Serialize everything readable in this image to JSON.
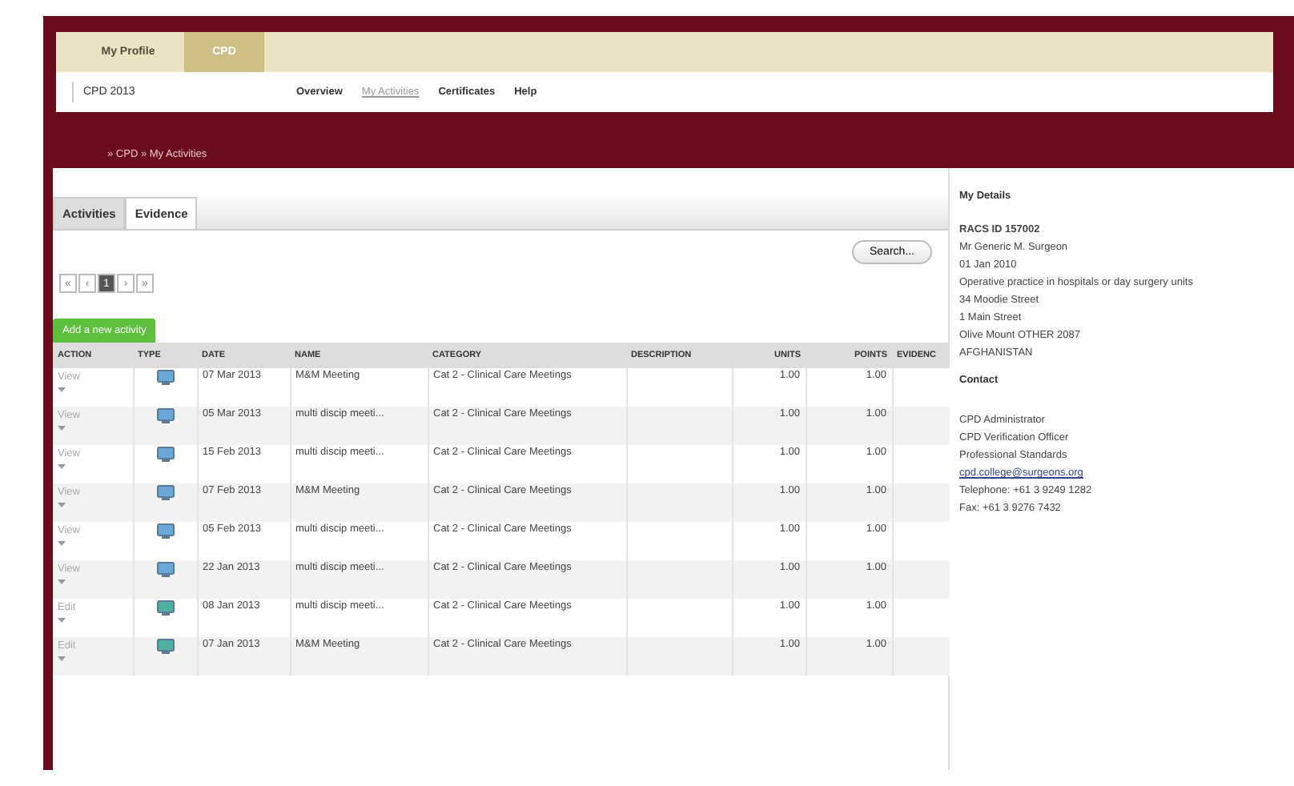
{
  "top_tabs": [
    {
      "label": "My Profile",
      "selected": false
    },
    {
      "label": "CPD",
      "selected": true
    }
  ],
  "year_field": {
    "value": "CPD 2013"
  },
  "nav": [
    {
      "label": "Overview",
      "selected": false
    },
    {
      "label": "My Activities",
      "selected": true
    },
    {
      "label": "Certificates",
      "selected": false
    },
    {
      "label": "Help",
      "selected": false
    }
  ],
  "breadcrumb": "» CPD » My Activities",
  "tabs": [
    {
      "label": "Activities",
      "selected": true
    },
    {
      "label": "Evidence",
      "selected": false
    }
  ],
  "search_button": "Search...",
  "pagination": [
    {
      "label": "«",
      "selected": false
    },
    {
      "label": "‹",
      "selected": false
    },
    {
      "label": "1",
      "selected": true
    },
    {
      "label": "›",
      "selected": false
    },
    {
      "label": "»",
      "selected": false
    }
  ],
  "add_button": "Add a new activity",
  "table": {
    "columns": [
      "ACTION",
      "TYPE",
      "DATE",
      "NAME",
      "CATEGORY",
      "DESCRIPTION",
      "UNITS",
      "POINTS",
      "EVIDENC"
    ],
    "rows": [
      {
        "action": "View",
        "kind": "view",
        "date": "07 Mar 2013",
        "name": "M&M Meeting",
        "category": "Cat 2 - Clinical Care Meetings",
        "units": "1.00",
        "points": "1.00"
      },
      {
        "action": "View",
        "kind": "view",
        "date": "05 Mar 2013",
        "name": "multi discip meeti...",
        "category": "Cat 2 - Clinical Care Meetings",
        "units": "1.00",
        "points": "1.00"
      },
      {
        "action": "View",
        "kind": "view",
        "date": "15 Feb 2013",
        "name": "multi discip meeti...",
        "category": "Cat 2 - Clinical Care Meetings",
        "units": "1.00",
        "points": "1.00"
      },
      {
        "action": "View",
        "kind": "view",
        "date": "07 Feb 2013",
        "name": "M&M Meeting",
        "category": "Cat 2 - Clinical Care Meetings",
        "units": "1.00",
        "points": "1.00"
      },
      {
        "action": "View",
        "kind": "view",
        "date": "05 Feb 2013",
        "name": "multi discip meeti...",
        "category": "Cat 2 - Clinical Care Meetings",
        "units": "1.00",
        "points": "1.00"
      },
      {
        "action": "View",
        "kind": "view",
        "date": "22 Jan 2013",
        "name": "multi discip meeti...",
        "category": "Cat 2 - Clinical Care Meetings",
        "units": "1.00",
        "points": "1.00"
      },
      {
        "action": "Edit",
        "kind": "edit",
        "date": "08 Jan 2013",
        "name": "multi discip meeti...",
        "category": "Cat 2 - Clinical Care Meetings",
        "units": "1.00",
        "points": "1.00"
      },
      {
        "action": "Edit",
        "kind": "edit",
        "date": "07 Jan 2013",
        "name": "M&M Meeting",
        "category": "Cat 2 - Clinical Care Meetings",
        "units": "1.00",
        "points": "1.00"
      }
    ]
  },
  "sidebar": {
    "title": "My Details",
    "details": [
      "RACS ID 157002",
      "Mr Generic M. Surgeon",
      "01 Jan 2010",
      "Operative practice in hospitals or day surgery units",
      "34 Moodie Street",
      "1 Main Street",
      "Olive Mount OTHER 2087",
      "AFGHANISTAN"
    ],
    "contact_title": "Contact",
    "contact": [
      "CPD Administrator",
      "CPD Verification Officer",
      "Professional Standards"
    ],
    "email": "cpd.college@surgeons.org",
    "phones": [
      "Telephone: +61 3 9249 1282",
      "Fax: +61 3 9276 7432"
    ]
  }
}
